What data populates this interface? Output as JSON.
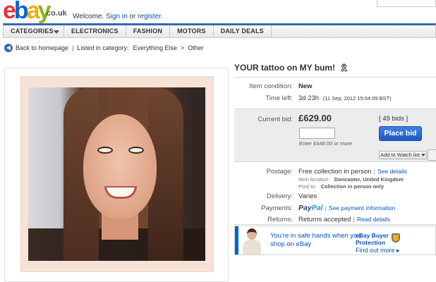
{
  "header": {
    "logo_text": "ebay",
    "logo_suffix": ".co.uk",
    "welcome": "Welcome.",
    "sign_in": "Sign in",
    "or": "or",
    "register": "register."
  },
  "nav": {
    "items": [
      "CATEGORIES",
      "ELECTRONICS",
      "FASHION",
      "MOTORS",
      "DAILY DEALS"
    ]
  },
  "breadcrumb": {
    "back": "Back to homepage",
    "listed_in": "Listed in category:",
    "category": "Everything Else",
    "separator": ">",
    "subcategory": "Other"
  },
  "listing": {
    "title": "YOUR tattoo on MY bum!",
    "item_condition_label": "Item condition:",
    "item_condition": "New",
    "time_left_label": "Time left:",
    "time_left": "3d 23h",
    "end_time": "(11 Sep, 2012  15:04:09 BST)",
    "current_bid_label": "Current bid:",
    "current_bid": "£629.00",
    "bids": "[ 49 bids ]",
    "bid_hint": "Enter £649.00 or more",
    "place_bid": "Place bid",
    "watch_list": "Add to Watch list",
    "postage_label": "Postage:",
    "postage": "Free collection in person",
    "see_details": "See details",
    "item_location_label": "Item location:",
    "item_location": "Doncaster, United Kingdom",
    "post_to_label": "Post to:",
    "post_to": "Collection in person only",
    "delivery_label": "Delivery:",
    "delivery": "Varies",
    "payments_label": "Payments:",
    "paypal_a": "Pay",
    "paypal_b": "Pal",
    "payment_info": "See payment information",
    "returns_label": "Returns:",
    "returns": "Returns accepted",
    "read_details": "Read details"
  },
  "promo": {
    "message": "You're in safe hands when you shop on eBay",
    "protection_title": "eBay Buyer Protection",
    "find_out_more": "Find out more ▸"
  },
  "colors": {
    "ebay_e": "#e53238",
    "ebay_b": "#0064d2",
    "ebay_a": "#f5af02",
    "ebay_y": "#86b817",
    "link": "#0654ba",
    "place_bid": "#1f58c4"
  }
}
